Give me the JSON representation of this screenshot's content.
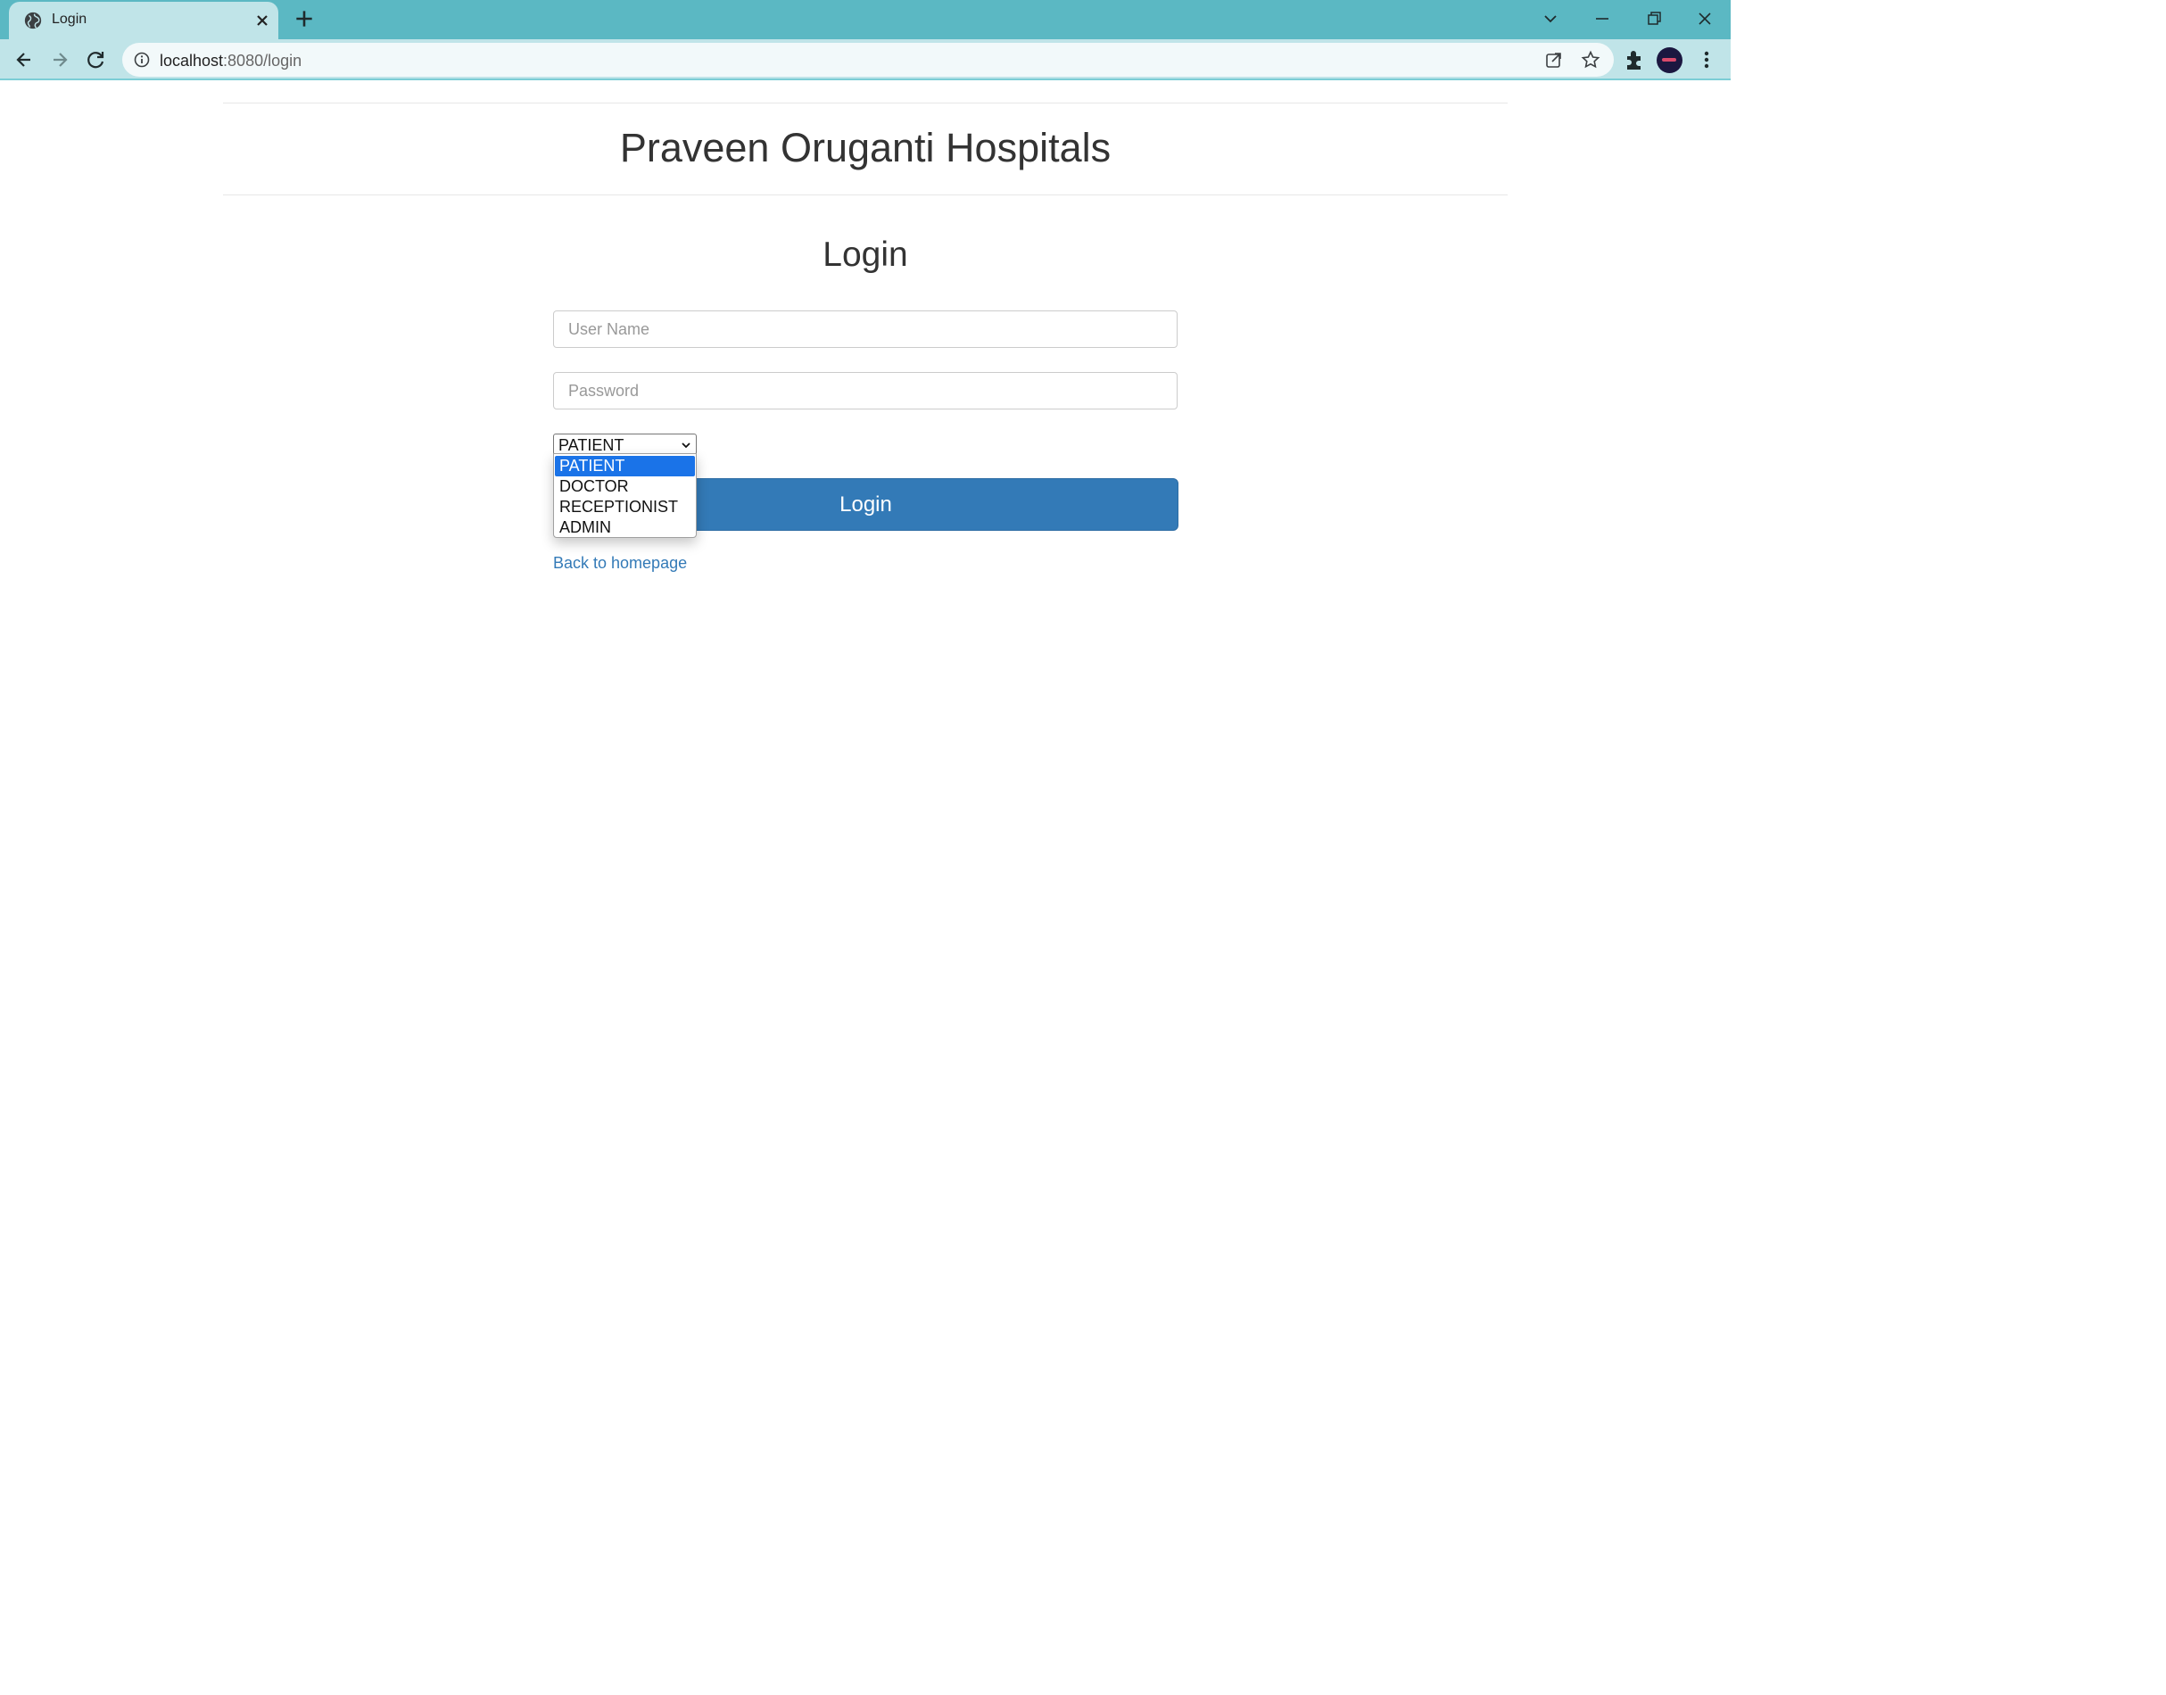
{
  "browser": {
    "tab": {
      "title": "Login"
    },
    "url": {
      "host": "localhost",
      "path": ":8080/login"
    }
  },
  "page": {
    "site_title": "Praveen Oruganti Hospitals",
    "login_heading": "Login",
    "username": {
      "placeholder": "User Name",
      "value": ""
    },
    "password": {
      "placeholder": "Password",
      "value": ""
    },
    "role_select": {
      "selected": "PATIENT",
      "options": [
        "PATIENT",
        "DOCTOR",
        "RECEPTIONIST",
        "ADMIN"
      ],
      "expanded": true,
      "highlighted": "PATIENT"
    },
    "login_button": "Login",
    "back_link": "Back to homepage"
  },
  "colors": {
    "tabstrip": "#5bb8c3",
    "toolbar": "#c0e4e8",
    "primary_button": "#337ab7",
    "link": "#337ab7",
    "dropdown_highlight": "#1a73e8"
  }
}
